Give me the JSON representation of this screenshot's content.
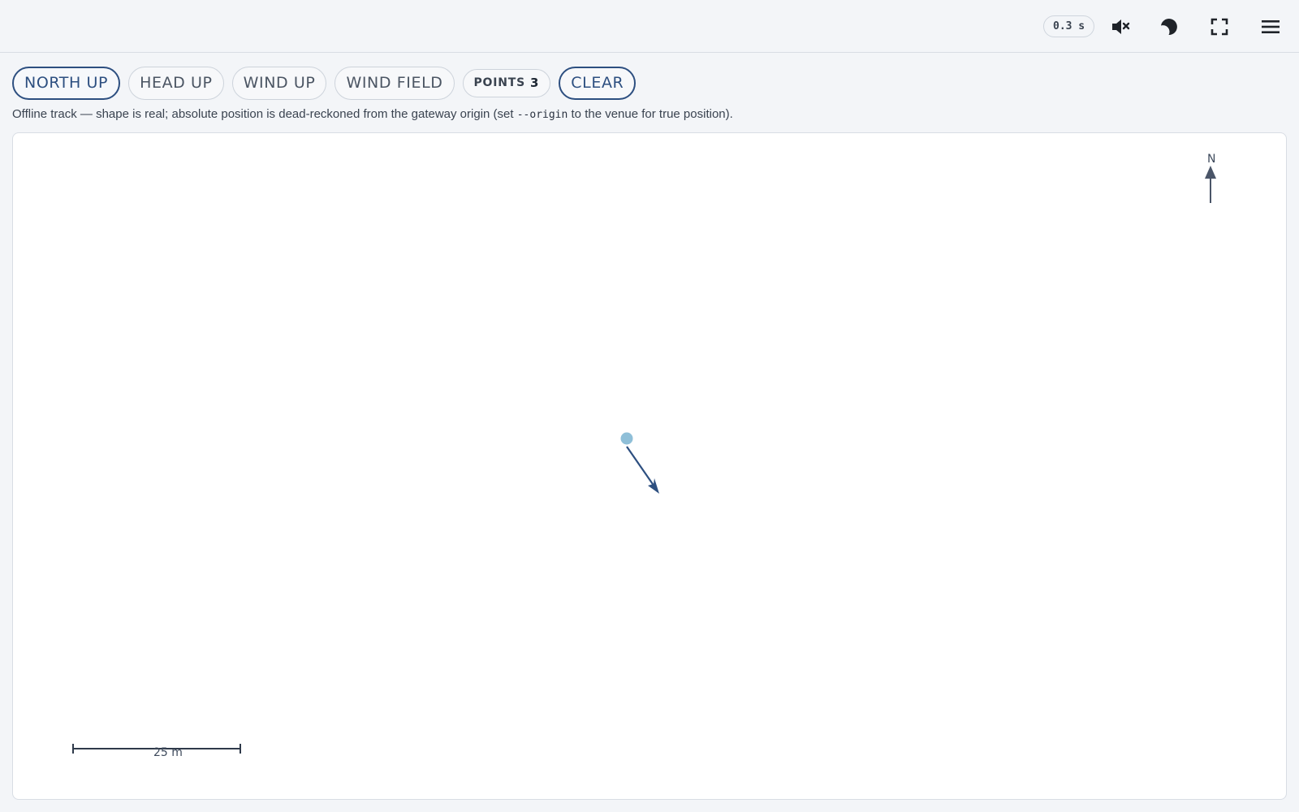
{
  "topbar": {
    "latency": "0.3 s",
    "icons": {
      "mute": "speaker-muted-icon",
      "theme": "moon-icon",
      "fullscreen": "fullscreen-icon",
      "menu": "hamburger-menu-icon"
    }
  },
  "controls": {
    "north_up": "NORTH UP",
    "head_up": "HEAD UP",
    "wind_up": "WIND UP",
    "wind_field": "WIND FIELD",
    "points_label": "POINTS",
    "points_count": "3",
    "clear": "CLEAR",
    "active_mode": "NORTH UP"
  },
  "notice": {
    "before": "Offline track — shape is real; absolute position is dead-reckoned from the gateway origin (set ",
    "code": "--origin",
    "after": " to the venue for true position)."
  },
  "map": {
    "compass_label": "N",
    "scale_label": "25 m",
    "colors": {
      "track": "#2d4f80",
      "start_dot": "#8fbfd8",
      "compass": "#4a5568",
      "scale": "#2f3a4a"
    }
  }
}
